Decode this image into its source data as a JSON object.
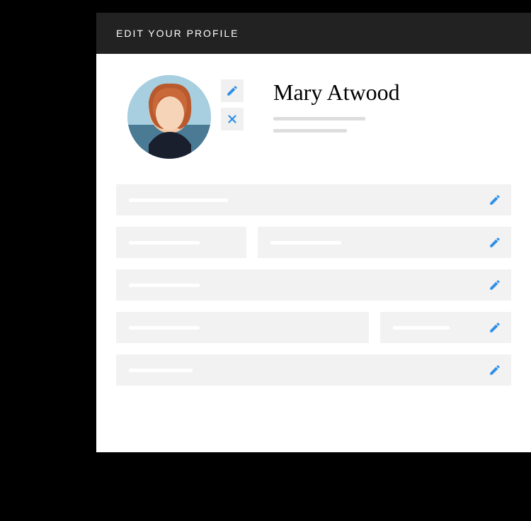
{
  "header": {
    "title": "EDIT YOUR PROFILE"
  },
  "profile": {
    "display_name": "Mary Atwood",
    "avatar_edit_icon": "pencil-icon",
    "avatar_remove_icon": "close-icon"
  },
  "fields": [
    {
      "layout": "full",
      "editable": true
    },
    {
      "layout": "split-33-60",
      "editable_right": true
    },
    {
      "layout": "full",
      "editable": true
    },
    {
      "layout": "split-64-30",
      "editable_right": true
    },
    {
      "layout": "full",
      "editable": true
    }
  ],
  "colors": {
    "accent": "#2F8FE8",
    "field_bg": "#f2f2f2",
    "header_bg": "#222222"
  }
}
